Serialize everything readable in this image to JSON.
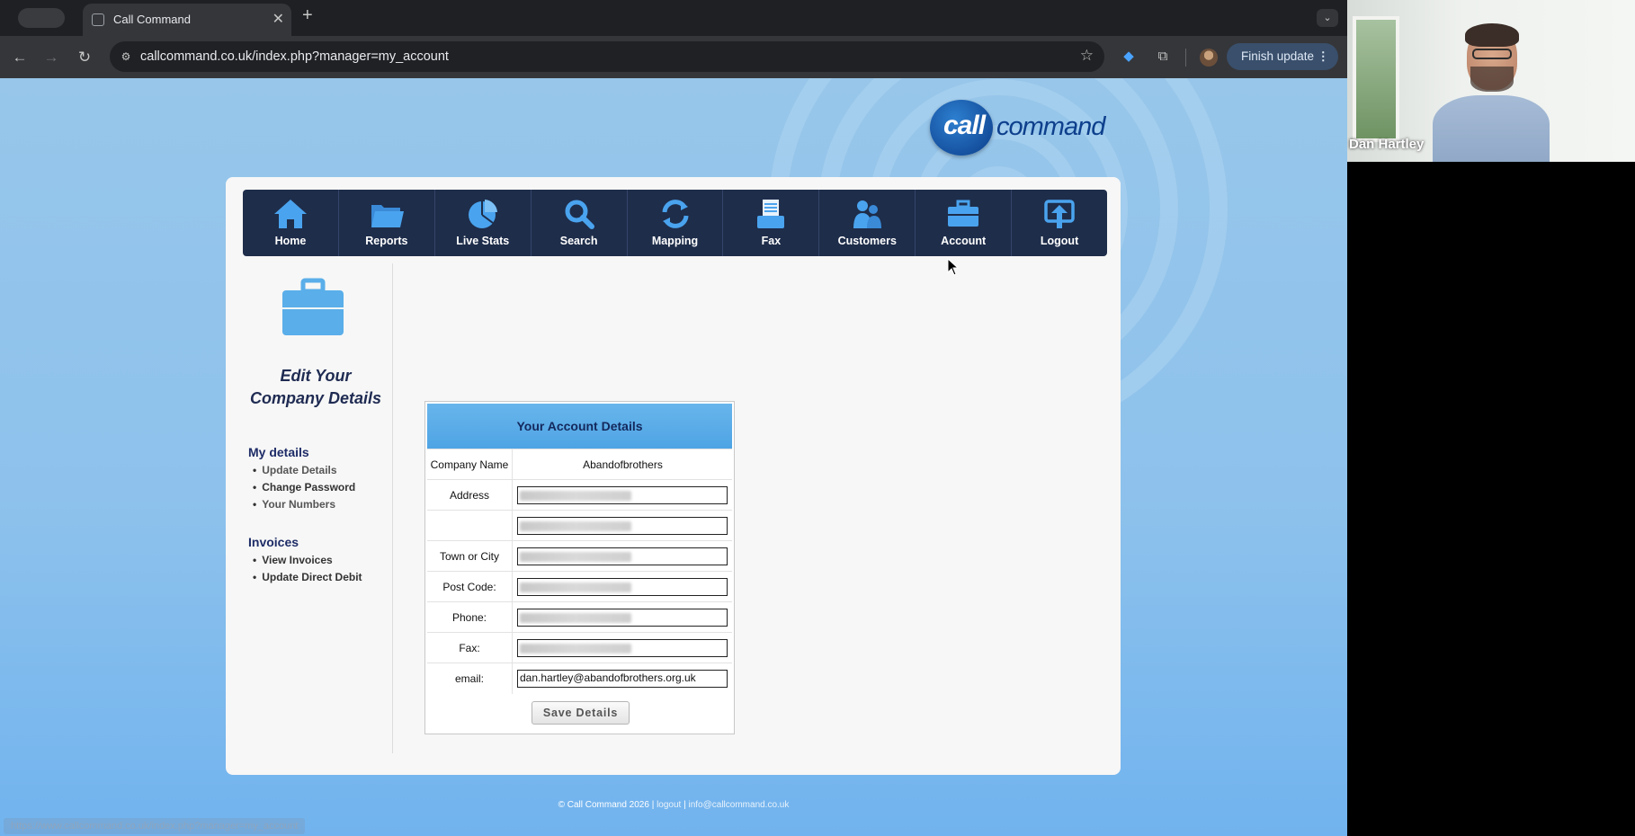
{
  "browser": {
    "tab_title": "Call Command",
    "url": "callcommand.co.uk/index.php?manager=my_account",
    "finish_update_label": "Finish update",
    "status_url": "https://www.callcommand.co.uk/index.php?manager=my_account"
  },
  "site": {
    "logo_call": "call",
    "logo_command": "command",
    "nav": [
      {
        "label": "Home",
        "icon": "home-icon"
      },
      {
        "label": "Reports",
        "icon": "folder-icon"
      },
      {
        "label": "Live Stats",
        "icon": "pie-chart-icon"
      },
      {
        "label": "Search",
        "icon": "search-icon"
      },
      {
        "label": "Mapping",
        "icon": "refresh-icon"
      },
      {
        "label": "Fax",
        "icon": "fax-icon"
      },
      {
        "label": "Customers",
        "icon": "users-icon"
      },
      {
        "label": "Account",
        "icon": "briefcase-icon"
      },
      {
        "label": "Logout",
        "icon": "upload-icon"
      }
    ],
    "sidebar": {
      "title_line1": "Edit Your",
      "title_line2": "Company Details",
      "my_details_heading": "My details",
      "my_details_links": [
        "Update Details",
        "Change Password",
        "Your Numbers"
      ],
      "invoices_heading": "Invoices",
      "invoices_links": [
        "View Invoices",
        "Update Direct Debit"
      ]
    },
    "account_form": {
      "heading": "Your Account Details",
      "company_name_label": "Company Name",
      "company_name_value": "Abandofbrothers",
      "address_label": "Address",
      "town_label": "Town or City",
      "postcode_label": "Post Code:",
      "phone_label": "Phone:",
      "fax_label": "Fax:",
      "email_label": "email:",
      "email_value": "dan.hartley@abandofbrothers.org.uk",
      "save_label": "Save Details"
    },
    "footer": {
      "copyright": "© Call Command 2026 |",
      "logout": "logout",
      "separator": "|",
      "email": "info@callcommand.co.uk"
    }
  },
  "video_call": {
    "participant_name": "Dan Hartley"
  },
  "colors": {
    "nav_bg": "#1e2d4a",
    "accent_blue": "#4ea4e4",
    "page_bg": "#8ec2ec"
  }
}
